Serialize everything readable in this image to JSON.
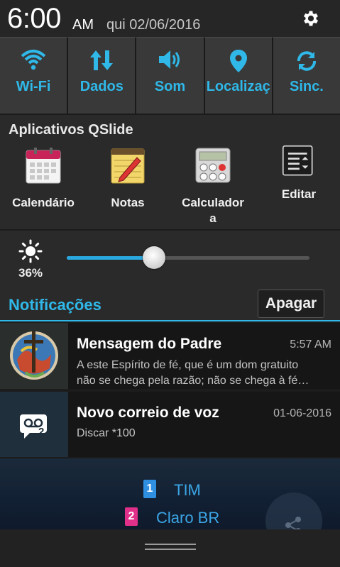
{
  "status": {
    "time": "6:00",
    "ampm": "AM",
    "date": "qui 02/06/2016",
    "settings_icon": "gear-icon"
  },
  "toggles": [
    {
      "label": "Wi-Fi",
      "icon": "wifi-icon"
    },
    {
      "label": "Dados",
      "icon": "data-arrows-icon"
    },
    {
      "label": "Som",
      "icon": "speaker-icon"
    },
    {
      "label": "Localizaç",
      "icon": "location-pin-icon"
    },
    {
      "label": "Sinc.",
      "icon": "sync-icon"
    }
  ],
  "qslide": {
    "title": "Aplicativos QSlide",
    "apps": [
      {
        "label": "Calendário",
        "icon": "calendar-icon"
      },
      {
        "label": "Notas",
        "icon": "notes-icon"
      },
      {
        "label": "Calculadora",
        "icon": "calculator-icon"
      },
      {
        "label": "Editar",
        "icon": "edit-list-icon"
      }
    ]
  },
  "brightness": {
    "percent_label": "36%",
    "level": 0.36
  },
  "notifications": {
    "header": "Notificações",
    "clear_label": "Apagar",
    "items": [
      {
        "title": "Mensagem do Padre",
        "time": "5:57 AM",
        "line1": "A este Espírito de fé, que é um dom gratuito",
        "line2": "não se chega pela razão; não se chega à fé…"
      },
      {
        "title": "Novo correio de voz",
        "time": "01-06-2016",
        "line1": "Discar *100"
      }
    ]
  },
  "carriers": [
    {
      "sim": "1",
      "name": "TIM",
      "color": "#2f8fe0"
    },
    {
      "sim": "2",
      "name": "Claro BR",
      "color": "#e0308a"
    }
  ],
  "colors": {
    "accent": "#2fb8e8"
  }
}
